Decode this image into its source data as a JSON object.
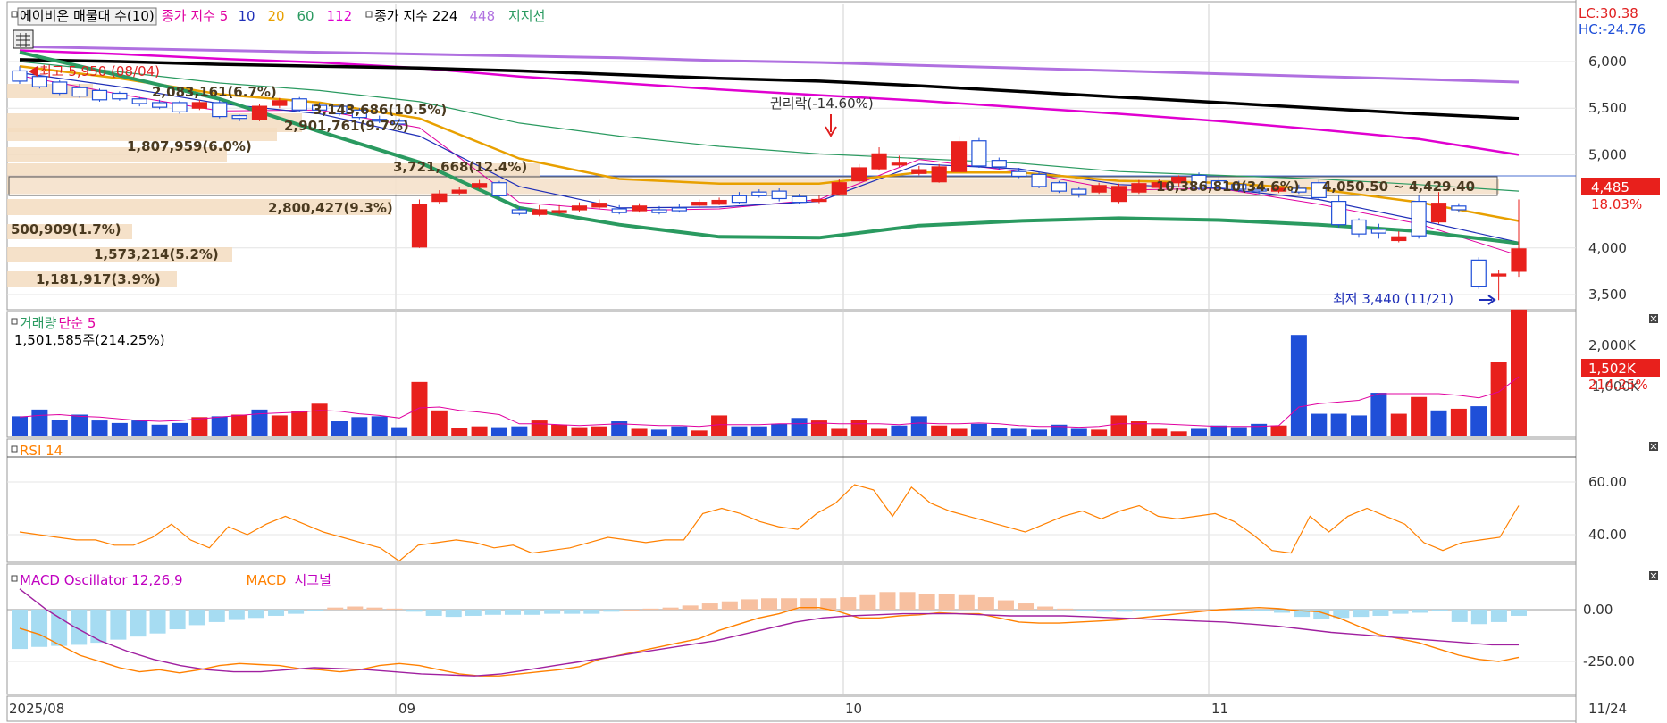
{
  "legends": {
    "price": [
      {
        "text": "에이비온 매물대 수(10)",
        "color": "#000000",
        "boxed": true
      },
      {
        "text": "종가 지수 5",
        "color": "#e000a0"
      },
      {
        "text": "10",
        "color": "#1f2fb8"
      },
      {
        "text": "20",
        "color": "#e8a000"
      },
      {
        "text": "60",
        "color": "#2a9a60"
      },
      {
        "text": "112",
        "color": "#e000d0"
      },
      {
        "text": "종가 지수 224",
        "color": "#000000",
        "marker": true
      },
      {
        "text": "448",
        "color": "#b070e0"
      },
      {
        "text": "지지선",
        "color": "#2a9a60"
      }
    ],
    "volume": [
      {
        "text": "거래량",
        "color": "#2a9a60"
      },
      {
        "text": "단순 5",
        "color": "#e000a0"
      }
    ],
    "volume_info": "1,501,585주(214.25%)",
    "rsi": [
      {
        "text": "RSI 14",
        "color": "#ff8000"
      }
    ],
    "macd": [
      {
        "text": "MACD Oscillator 12,26,9",
        "color": "#c000c0"
      },
      {
        "text": "MACD",
        "color": "#ff8000"
      },
      {
        "text": "시그널",
        "color": "#c000c0"
      }
    ]
  },
  "corner": {
    "lc": "LC:30.38",
    "hc": "HC:-24.76"
  },
  "price_axis": {
    "ticks": [
      "6,000",
      "5,500",
      "5,000",
      "4,000",
      "3,500"
    ],
    "current": "4,485",
    "change": "18.03%"
  },
  "volume_axis": {
    "ticks": [
      "2,000K"
    ],
    "current": "1,502K",
    "ratio": "214.25%",
    "hidden_tick": "1,000K"
  },
  "rsi_axis": {
    "ticks": [
      "60.00",
      "40.00"
    ]
  },
  "macd_axis": {
    "ticks": [
      "0.00",
      "-250.00"
    ]
  },
  "date_axis": {
    "labels": [
      "2025/08",
      "09",
      "10",
      "11",
      "11/24"
    ]
  },
  "annotations": {
    "high": "최고 5,950 (08/04)",
    "low": "최저 3,440 (11/21)",
    "rights": "권리락(-14.60%)",
    "volume_profile": [
      "2,083,161(6.7%)",
      "3,143,686(10.5%)",
      "2,901,761(9.7%)",
      "1,807,959(6.0%)",
      "3,721,668(12.4%)",
      "10,386,810(34.6%)",
      "2,800,427(9.3%)",
      "500,909(1.7%)",
      "1,573,214(5.2%)",
      "1,181,917(3.9%)"
    ],
    "range_box": "4,050.50 ~ 4,429.40"
  },
  "chart_data": [
    {
      "type": "candlestick",
      "panel": "price",
      "x": [
        "08/01",
        "08/04",
        "08/05",
        "08/06",
        "08/07",
        "08/08",
        "08/11",
        "08/12",
        "08/13",
        "08/14",
        "08/18",
        "08/19",
        "08/20",
        "08/21",
        "08/22",
        "08/25",
        "08/26",
        "08/27",
        "08/28",
        "08/29",
        "09/01",
        "09/02",
        "09/03",
        "09/04",
        "09/05",
        "09/08",
        "09/09",
        "09/10",
        "09/11",
        "09/12",
        "09/15",
        "09/16",
        "09/17",
        "09/18",
        "09/19",
        "09/22",
        "09/23",
        "09/24",
        "09/25",
        "09/26",
        "09/29",
        "09/30",
        "10/01",
        "10/02",
        "10/10",
        "10/13",
        "10/14",
        "10/15",
        "10/16",
        "10/17",
        "10/20",
        "10/21",
        "10/22",
        "10/23",
        "10/24",
        "10/27",
        "10/28",
        "10/29",
        "10/30",
        "10/31",
        "11/03",
        "11/04",
        "11/05",
        "11/06",
        "11/07",
        "11/10",
        "11/11",
        "11/12",
        "11/13",
        "11/14",
        "11/17",
        "11/18",
        "11/19",
        "11/20",
        "11/21",
        "11/24"
      ],
      "open": [
        5900,
        5840,
        5780,
        5720,
        5690,
        5660,
        5600,
        5560,
        5560,
        5500,
        5560,
        5420,
        5380,
        5530,
        5600,
        5530,
        5520,
        5480,
        5380,
        5360,
        4010,
        4500,
        4590,
        4650,
        4700,
        4410,
        4360,
        4380,
        4410,
        4440,
        4420,
        4400,
        4410,
        4430,
        4460,
        4470,
        4560,
        4600,
        4610,
        4550,
        4500,
        4580,
        4720,
        4850,
        4900,
        4800,
        4710,
        4820,
        5150,
        4940,
        4820,
        4790,
        4700,
        4630,
        4600,
        4500,
        4600,
        4650,
        4700,
        4780,
        4720,
        4680,
        4630,
        4610,
        4640,
        4700,
        4500,
        4300,
        4200,
        4080,
        4500,
        4280,
        4450,
        3870,
        3700,
        3750
      ],
      "close": [
        5790,
        5730,
        5660,
        5630,
        5590,
        5600,
        5550,
        5510,
        5460,
        5560,
        5410,
        5390,
        5520,
        5580,
        5480,
        5480,
        5440,
        5400,
        5370,
        5330,
        4470,
        4580,
        4620,
        4690,
        4560,
        4370,
        4410,
        4400,
        4450,
        4480,
        4380,
        4450,
        4380,
        4400,
        4490,
        4510,
        4490,
        4560,
        4530,
        4490,
        4520,
        4700,
        4860,
        5010,
        4910,
        4840,
        4870,
        5140,
        4880,
        4870,
        4770,
        4660,
        4610,
        4580,
        4670,
        4660,
        4690,
        4700,
        4760,
        4640,
        4650,
        4630,
        4620,
        4640,
        4600,
        4540,
        4250,
        4150,
        4160,
        4120,
        4130,
        4480,
        4410,
        3590,
        3720,
        3990
      ],
      "high": [
        5950,
        5860,
        5800,
        5760,
        5710,
        5680,
        5620,
        5590,
        5580,
        5590,
        5590,
        5430,
        5540,
        5610,
        5620,
        5560,
        5540,
        5500,
        5420,
        5390,
        4520,
        4620,
        4650,
        4730,
        4720,
        4440,
        4460,
        4460,
        4490,
        4520,
        4460,
        4480,
        4450,
        4470,
        4520,
        4540,
        4600,
        4630,
        4640,
        4580,
        4560,
        4740,
        4900,
        5080,
        4990,
        4880,
        4900,
        5200,
        5180,
        4970,
        4860,
        4810,
        4720,
        4660,
        4700,
        4690,
        4730,
        4740,
        4780,
        4810,
        4760,
        4720,
        4680,
        4670,
        4680,
        4730,
        4560,
        4320,
        4260,
        4180,
        4560,
        4600,
        4480,
        3900,
        3760,
        4520
      ],
      "low": [
        5760,
        5710,
        5640,
        5610,
        5570,
        5580,
        5520,
        5490,
        5440,
        5480,
        5390,
        5360,
        5360,
        5500,
        5460,
        5460,
        5420,
        5380,
        5340,
        5310,
        4000,
        4470,
        4560,
        4630,
        4540,
        4350,
        4340,
        4360,
        4390,
        4420,
        4360,
        4380,
        4360,
        4380,
        4440,
        4460,
        4470,
        4540,
        4500,
        4470,
        4480,
        4560,
        4700,
        4830,
        4870,
        4780,
        4700,
        4800,
        4860,
        4840,
        4750,
        4640,
        4590,
        4540,
        4580,
        4480,
        4580,
        4620,
        4660,
        4620,
        4620,
        4600,
        4580,
        4590,
        4580,
        4520,
        4220,
        4110,
        4100,
        4060,
        4100,
        4260,
        4380,
        3560,
        3440,
        3690
      ]
    },
    {
      "type": "line",
      "panel": "price",
      "name": "price-moving-averages",
      "x": [
        "08/01",
        "08/08",
        "08/18",
        "08/25",
        "09/01",
        "09/08",
        "09/15",
        "09/22",
        "09/29",
        "10/13",
        "10/20",
        "10/27",
        "11/03",
        "11/10",
        "11/17",
        "11/24"
      ],
      "series": [
        {
          "name": "5",
          "values": [
            5850,
            5650,
            5470,
            5480,
            5290,
            4490,
            4400,
            4420,
            4520,
            4950,
            4820,
            4620,
            4640,
            4470,
            4260,
            3920
          ]
        },
        {
          "name": "10",
          "values": [
            5880,
            5730,
            5550,
            5440,
            5200,
            4660,
            4430,
            4440,
            4500,
            4900,
            4850,
            4680,
            4640,
            4520,
            4300,
            4060
          ]
        },
        {
          "name": "20",
          "values": [
            5950,
            5820,
            5650,
            5560,
            5390,
            4960,
            4740,
            4690,
            4690,
            4810,
            4810,
            4720,
            4700,
            4630,
            4490,
            4290
          ]
        },
        {
          "name": "60",
          "values": [
            6000,
            5890,
            5770,
            5690,
            5570,
            5340,
            5200,
            5090,
            5010,
            4960,
            4910,
            4820,
            4780,
            4740,
            4680,
            4610
          ]
        },
        {
          "name": "112",
          "values": [
            6120,
            6080,
            6030,
            5990,
            5930,
            5840,
            5770,
            5700,
            5640,
            5580,
            5510,
            5440,
            5360,
            5270,
            5170,
            5000
          ]
        },
        {
          "name": "224",
          "values": [
            6020,
            6000,
            5970,
            5950,
            5930,
            5900,
            5860,
            5820,
            5790,
            5740,
            5680,
            5620,
            5560,
            5500,
            5440,
            5390
          ]
        },
        {
          "name": "448",
          "values": [
            6160,
            6140,
            6120,
            6100,
            6080,
            6060,
            6040,
            6010,
            5990,
            5960,
            5930,
            5900,
            5870,
            5840,
            5810,
            5780
          ]
        },
        {
          "name": "지지선",
          "values": [
            6100,
            5850,
            5600,
            5250,
            4920,
            4430,
            4250,
            4120,
            4110,
            4240,
            4290,
            4320,
            4300,
            4250,
            4180,
            4050
          ]
        }
      ]
    },
    {
      "type": "bar",
      "panel": "volume",
      "unit": "K",
      "values": [
        230,
        310,
        190,
        250,
        180,
        150,
        180,
        130,
        150,
        220,
        230,
        250,
        310,
        240,
        290,
        380,
        170,
        220,
        230,
        100,
        640,
        300,
        90,
        110,
        100,
        110,
        180,
        130,
        100,
        110,
        170,
        80,
        70,
        110,
        60,
        240,
        110,
        110,
        140,
        210,
        180,
        80,
        190,
        80,
        120,
        230,
        120,
        80,
        140,
        90,
        80,
        70,
        130,
        80,
        70,
        240,
        170,
        80,
        50,
        80,
        120,
        100,
        140,
        120,
        1200,
        260,
        260,
        240,
        510,
        260,
        460,
        300,
        320,
        350,
        880,
        1502
      ],
      "up": [
        0,
        0,
        0,
        0,
        0,
        0,
        0,
        0,
        0,
        1,
        0,
        1,
        0,
        1,
        1,
        1,
        0,
        0,
        0,
        0,
        1,
        1,
        1,
        1,
        0,
        0,
        1,
        1,
        1,
        1,
        0,
        1,
        0,
        0,
        1,
        1,
        0,
        0,
        0,
        0,
        1,
        1,
        1,
        1,
        0,
        0,
        1,
        1,
        0,
        0,
        0,
        0,
        0,
        0,
        1,
        1,
        1,
        1,
        1,
        0,
        0,
        0,
        0,
        1,
        0,
        0,
        0,
        0,
        0,
        1,
        1,
        0,
        1,
        0,
        1,
        1
      ],
      "ma5": [
        220,
        240,
        250,
        230,
        220,
        200,
        180,
        170,
        180,
        200,
        220,
        240,
        260,
        270,
        280,
        300,
        290,
        260,
        240,
        210,
        330,
        340,
        300,
        280,
        250,
        140,
        140,
        130,
        120,
        130,
        140,
        130,
        120,
        120,
        110,
        130,
        130,
        130,
        140,
        140,
        150,
        140,
        140,
        140,
        130,
        150,
        140,
        140,
        150,
        140,
        120,
        110,
        110,
        100,
        110,
        140,
        140,
        140,
        130,
        120,
        110,
        110,
        110,
        120,
        340,
        380,
        400,
        420,
        500,
        500,
        500,
        500,
        480,
        450,
        520,
        700
      ]
    },
    {
      "type": "line",
      "panel": "rsi",
      "name": "RSI 14",
      "values": [
        41,
        40,
        39,
        38,
        38,
        36,
        36,
        39,
        44,
        38,
        35,
        43,
        40,
        44,
        47,
        44,
        41,
        39,
        37,
        35,
        30,
        36,
        37,
        38,
        37,
        35,
        36,
        33,
        34,
        35,
        37,
        39,
        38,
        37,
        38,
        38,
        48,
        50,
        48,
        45,
        43,
        42,
        48,
        52,
        59,
        57,
        47,
        58,
        52,
        49,
        47,
        45,
        43,
        41,
        44,
        47,
        49,
        46,
        49,
        51,
        47,
        46,
        47,
        48,
        45,
        40,
        34,
        33,
        47,
        41,
        47,
        50,
        47,
        44,
        37,
        34,
        37,
        38,
        39,
        51
      ]
    },
    {
      "type": "bar",
      "panel": "macd",
      "name": "oscillator",
      "values": [
        -190,
        -180,
        -175,
        -170,
        -160,
        -145,
        -130,
        -115,
        -95,
        -75,
        -60,
        -50,
        -40,
        -30,
        -20,
        -5,
        10,
        15,
        10,
        5,
        -10,
        -30,
        -35,
        -30,
        -25,
        -25,
        -25,
        -20,
        -20,
        -20,
        -10,
        0,
        5,
        10,
        20,
        30,
        40,
        50,
        55,
        55,
        55,
        55,
        60,
        70,
        85,
        85,
        75,
        75,
        70,
        60,
        45,
        30,
        15,
        5,
        -5,
        -10,
        -10,
        -5,
        -5,
        0,
        0,
        0,
        -5,
        -5,
        -15,
        -35,
        -45,
        -40,
        -35,
        -30,
        -20,
        -15,
        -5,
        -60,
        -70,
        -60,
        -30
      ]
    },
    {
      "type": "line",
      "panel": "macd",
      "name": "macd-lines",
      "series": [
        {
          "name": "MACD",
          "values": [
            -90,
            -120,
            -170,
            -220,
            -250,
            -280,
            -300,
            -290,
            -305,
            -290,
            -270,
            -260,
            -265,
            -270,
            -285,
            -290,
            -300,
            -290,
            -270,
            -260,
            -270,
            -290,
            -310,
            -320,
            -320,
            -310,
            -300,
            -290,
            -275,
            -240,
            -220,
            -200,
            -180,
            -160,
            -140,
            -100,
            -70,
            -40,
            -20,
            10,
            10,
            -10,
            -40,
            -40,
            -30,
            -25,
            -15,
            -20,
            -20,
            -40,
            -60,
            -65,
            -65,
            -60,
            -55,
            -50,
            -40,
            -30,
            -20,
            -10,
            0,
            5,
            10,
            5,
            -5,
            -10,
            -40,
            -80,
            -120,
            -140,
            -160,
            -190,
            -220,
            -240,
            -250,
            -230
          ]
        },
        {
          "name": "시그널",
          "values": [
            100,
            0,
            -80,
            -150,
            -200,
            -240,
            -270,
            -290,
            -300,
            -300,
            -290,
            -280,
            -285,
            -290,
            -300,
            -310,
            -315,
            -320,
            -310,
            -290,
            -270,
            -250,
            -230,
            -210,
            -190,
            -170,
            -150,
            -120,
            -90,
            -60,
            -40,
            -30,
            -25,
            -20,
            -20,
            -20,
            -25,
            -30,
            -30,
            -30,
            -35,
            -40,
            -45,
            -50,
            -55,
            -60,
            -70,
            -80,
            -95,
            -110,
            -120,
            -130,
            -140,
            -150,
            -160,
            -170,
            -170
          ]
        }
      ]
    }
  ]
}
